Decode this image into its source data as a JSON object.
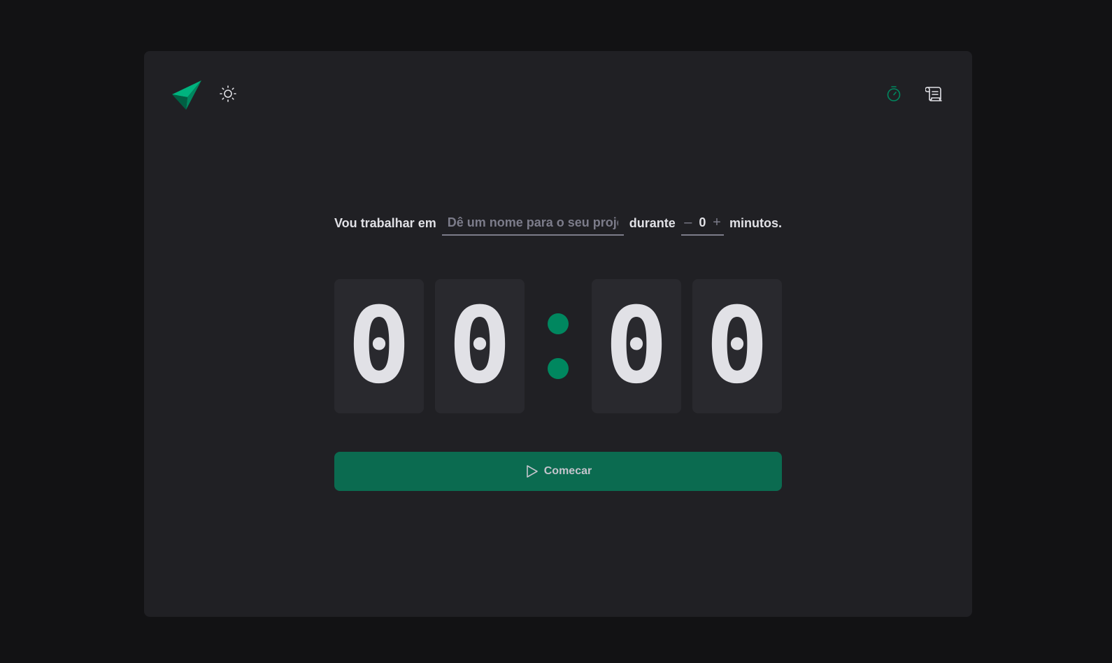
{
  "colors": {
    "background": "#121214",
    "card": "#202024",
    "digit_box": "#29292e",
    "accent": "#00875f",
    "button": "#0b6b50",
    "text": "#e1e1e6",
    "muted": "#7c7c8a"
  },
  "header": {
    "logo_icon": "paper-plane-logo-icon",
    "theme_icon": "sun-icon",
    "nav": [
      {
        "icon": "timer-icon",
        "active": true
      },
      {
        "icon": "history-scroll-icon",
        "active": false
      }
    ]
  },
  "form": {
    "label_task": "Vou trabalhar em",
    "project_placeholder": "Dê um nome para o seu projeto",
    "project_value": "",
    "label_duration": "durante",
    "minus_label": "–",
    "minutes_value": "0",
    "plus_label": "+",
    "label_unit": "minutos."
  },
  "countdown": {
    "minutes_tens": "0",
    "minutes_units": "0",
    "separator": ":",
    "seconds_tens": "0",
    "seconds_units": "0"
  },
  "start_button": {
    "icon": "play-icon",
    "label": "Comecar"
  }
}
